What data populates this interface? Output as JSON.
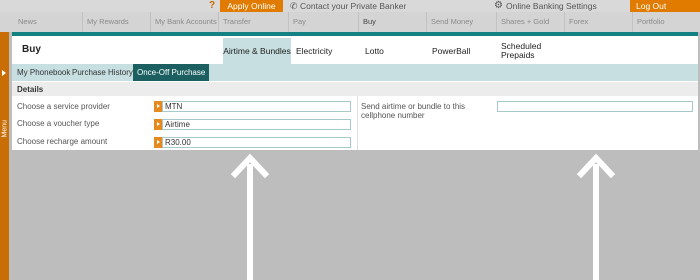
{
  "utility_bar": {
    "help_glyph": "?",
    "apply_label": "Apply Online Now",
    "contact_label": "Contact your Private Banker",
    "settings_label": "Online Banking Settings",
    "logout_label": "Log Out"
  },
  "main_nav": {
    "items": [
      {
        "label": "News"
      },
      {
        "label": "My Rewards"
      },
      {
        "label": "My Bank Accounts"
      },
      {
        "label": "Transfer"
      },
      {
        "label": "Pay"
      },
      {
        "label": "Buy"
      },
      {
        "label": "Send Money"
      },
      {
        "label": "Shares + Gold"
      },
      {
        "label": "Forex"
      },
      {
        "label": "Portfolio"
      }
    ],
    "active": "Buy"
  },
  "side_menu": {
    "label": "Menu"
  },
  "buy": {
    "title": "Buy",
    "tabs": [
      {
        "label": "Airtime & Bundles"
      },
      {
        "label": "Electricity"
      },
      {
        "label": "Lotto"
      },
      {
        "label": "PowerBall"
      },
      {
        "label": "Scheduled Prepaids"
      }
    ],
    "active_tab": "Airtime & Bundles",
    "subtabs": [
      {
        "label": "My Phonebook"
      },
      {
        "label": "Purchase History"
      },
      {
        "label": "Once-Off Purchase"
      }
    ],
    "active_subtab": "Once-Off Purchase"
  },
  "details": {
    "heading": "Details",
    "service_provider": {
      "label": "Choose a service provider",
      "value": "MTN"
    },
    "voucher_type": {
      "label": "Choose a voucher type",
      "value": "Airtime"
    },
    "recharge_amount": {
      "label": "Choose recharge amount",
      "value": "R30.00"
    },
    "cellphone": {
      "label": "Send airtime or bundle to this cellphone number",
      "value": ""
    }
  },
  "colors": {
    "accent_orange": "#e07b00",
    "teal": "#148283",
    "teal_light": "#c7dfe0",
    "teal_dark": "#1b5f60"
  }
}
